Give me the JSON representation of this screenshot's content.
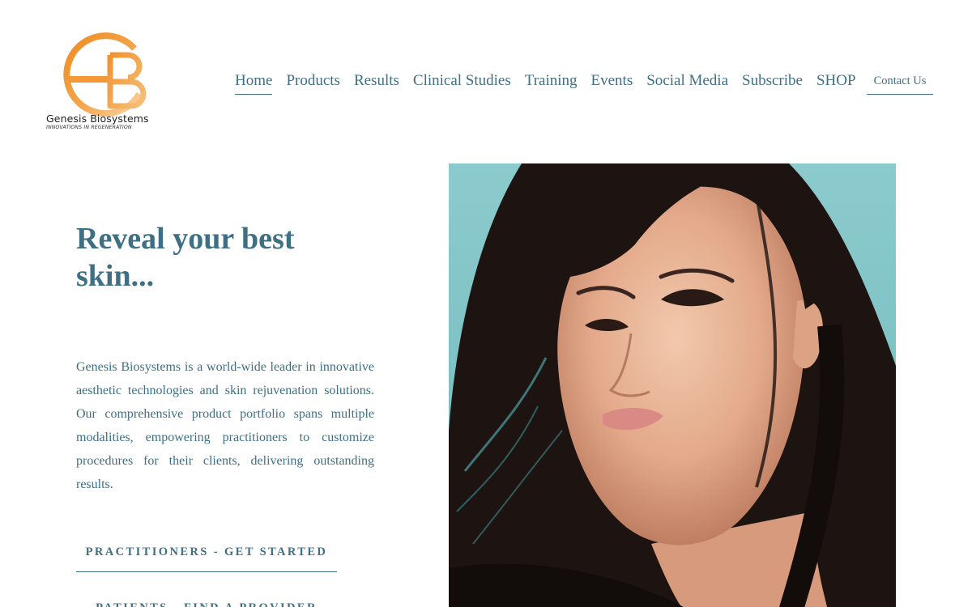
{
  "brand": {
    "name": "Genesis Biosystems",
    "tagline": "INNOVATIONS IN REGENERATION",
    "monogram": "GB",
    "colors": {
      "logo_orange": "#f0932f",
      "logo_light": "#f6c27e",
      "accent": "#3f6f84"
    }
  },
  "nav": {
    "items": [
      {
        "label": "Home",
        "active": true
      },
      {
        "label": "Products",
        "active": false
      },
      {
        "label": "Results",
        "active": false
      },
      {
        "label": "Clinical Studies",
        "active": false
      },
      {
        "label": "Training",
        "active": false
      },
      {
        "label": "Events",
        "active": false
      },
      {
        "label": "Social Media",
        "active": false
      },
      {
        "label": "Subscribe",
        "active": false
      },
      {
        "label": "SHOP",
        "active": false
      }
    ],
    "contact_label": "Contact Us"
  },
  "hero": {
    "title": "Reveal your best skin...",
    "description": "Genesis Biosystems is a world-wide leader in innovative aesthetic technologies and skin rejuvenation solutions. Our comprehensive product portfolio spans multiple modalities, empowering practitioners to customize procedures for their clients, delivering outstanding results.",
    "cta_primary": "PRACTITIONERS - GET STARTED",
    "cta_secondary": "PATIENTS - FIND A PROVIDER",
    "image": "portrait-photo"
  }
}
